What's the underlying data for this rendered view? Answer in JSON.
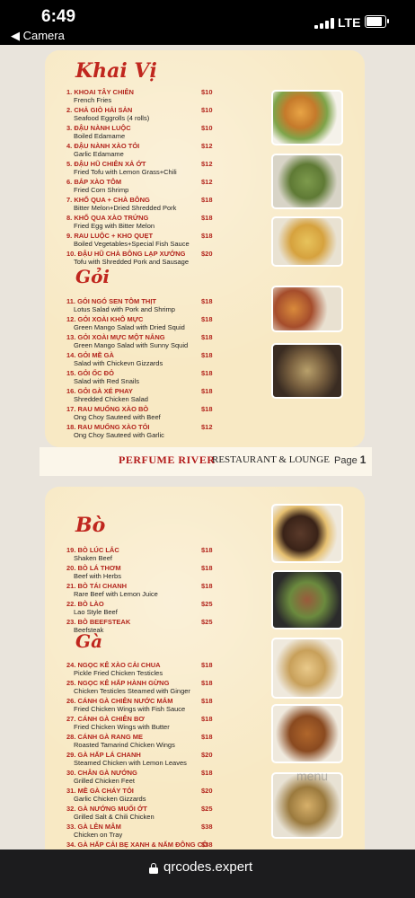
{
  "status": {
    "time": "6:49",
    "back_label": "◀ Camera",
    "network": "LTE"
  },
  "browser": {
    "url": "qrcodes.expert"
  },
  "footer": {
    "brand": "PERFUME RIVER",
    "restaurant": "RESTAURANT & LOUNGE",
    "page_label": "Page",
    "page_number": "1"
  },
  "watermark": "menu",
  "sections": [
    {
      "title": "Khai Vị",
      "items": [
        {
          "vn": "1. KHOAI TÂY CHIÊN",
          "en": "French Fries",
          "price": "$10"
        },
        {
          "vn": "2. CHẢ GIÒ HẢI SẢN",
          "en": "Seafood Eggrolls (4 rolls)",
          "price": "$10"
        },
        {
          "vn": "3. ĐẬU NÀNH LUỘC",
          "en": "Boiled Edamame",
          "price": "$10"
        },
        {
          "vn": "4. ĐẬU NÀNH XÀO TỎI",
          "en": "Garlic Edamame",
          "price": "$12"
        },
        {
          "vn": "5. ĐẬU HŨ CHIÊN XẢ ỚT",
          "en": "Fried Tofu with Lemon Grass+Chili",
          "price": "$12"
        },
        {
          "vn": "6. BẮP XÀO TÔM",
          "en": "Fried Corn Shrimp",
          "price": "$12"
        },
        {
          "vn": "7. KHỔ QUA + CHÀ BÔNG",
          "en": "Bitter Melon+Dried Shredded Pork",
          "price": "$18"
        },
        {
          "vn": "8. KHỔ QUA XÀO TRỨNG",
          "en": "Fried Egg with Bitter Melon",
          "price": "$18"
        },
        {
          "vn": "9. RAU LUỘC + KHO QUẸT",
          "en": "Boiled Vegetables+Special Fish Sauce",
          "price": "$18"
        },
        {
          "vn": "10. ĐẬU HŨ CHÀ BÔNG LẠP XƯỞNG",
          "en": "Tofu with Shredded Pork and Sausage",
          "price": "$20"
        }
      ]
    },
    {
      "title": "Gỏi",
      "items": [
        {
          "vn": "11. GỎI NGÓ SEN TÔM THỊT",
          "en": "Lotus Salad with Pork and Shrimp",
          "price": "$18"
        },
        {
          "vn": "12. GỎI XOÀI KHÔ MỰC",
          "en": "Green Mango Salad with Dried Squid",
          "price": "$18"
        },
        {
          "vn": "13. GỎI XOÀI MỰC MỘT NẮNG",
          "en": "Green Mango Salad with Sunny Squid",
          "price": "$18"
        },
        {
          "vn": "14. GỎI MỀ GÀ",
          "en": "Salad with Chickevn Gizzards",
          "price": "$18"
        },
        {
          "vn": "15. GỎI ỐC ĐỎ",
          "en": "Salad with Red Snails",
          "price": "$18"
        },
        {
          "vn": "16. GỎI GÀ XÉ PHAY",
          "en": "Shredded Chicken Salad",
          "price": "$18"
        },
        {
          "vn": "17. RAU MUỐNG XÀO BÒ",
          "en": "Ong Choy Sauteed with Beef",
          "price": "$18"
        },
        {
          "vn": "18. RAU MUỐNG XÀO TỎI",
          "en": "Ong Choy Sauteed with Garlic",
          "price": "$12"
        }
      ]
    },
    {
      "title": "Bò",
      "items": [
        {
          "vn": "19. BÒ LÚC LẮC",
          "en": "Shaken Beef",
          "price": "$18"
        },
        {
          "vn": "20. BÒ LÁ THƠM",
          "en": "Beef with Herbs",
          "price": "$18"
        },
        {
          "vn": "21. BÒ TÁI CHANH",
          "en": "Rare Beef with Lemon Juice",
          "price": "$18"
        },
        {
          "vn": "22. BÒ LÀO",
          "en": "Lao Style Beef",
          "price": "$25"
        },
        {
          "vn": "23. BÒ BEEFSTEAK",
          "en": "Beefsteak",
          "price": "$25"
        }
      ]
    },
    {
      "title": "Gà",
      "items": [
        {
          "vn": "24. NGỌC KÊ XÀO CẢI CHUA",
          "en": "Pickle Fried Chicken Testicles",
          "price": "$18"
        },
        {
          "vn": "25. NGỌC KÊ HẤP HÀNH GỪNG",
          "en": "Chicken Testicles Steamed with Ginger",
          "price": "$18"
        },
        {
          "vn": "26. CÁNH GÀ CHIÊN NƯỚC MẮM",
          "en": "Fried Chicken Wings with Fish Sauce",
          "price": "$18"
        },
        {
          "vn": "27. CÁNH GÀ CHIÊN BƠ",
          "en": "Fried Chicken Wings with Butter",
          "price": "$18"
        },
        {
          "vn": "28. CÁNH GÀ RANG ME",
          "en": "Roasted Tamarind Chicken Wings",
          "price": "$18"
        },
        {
          "vn": "29. GÀ HẤP LÁ CHANH",
          "en": "Steamed Chicken with Lemon Leaves",
          "price": "$20"
        },
        {
          "vn": "30. CHÂN GÀ NƯỚNG",
          "en": "Grilled Chicken Feet",
          "price": "$18"
        },
        {
          "vn": "31. MỀ GÀ CHÁY TỎI",
          "en": "Garlic Chicken Gizzards",
          "price": "$20"
        },
        {
          "vn": "32. GÀ NƯỚNG MUỐI ỚT",
          "en": "Grilled Salt & Chili Chicken",
          "price": "$25"
        },
        {
          "vn": "33. GÀ LÊN MÂM",
          "en": "Chicken on Tray",
          "price": "$38"
        },
        {
          "vn": "34. GÀ HẤP CẢI BẸ XANH & NẤM ĐÔNG CÔ",
          "en": "",
          "price": "$38"
        }
      ]
    }
  ]
}
